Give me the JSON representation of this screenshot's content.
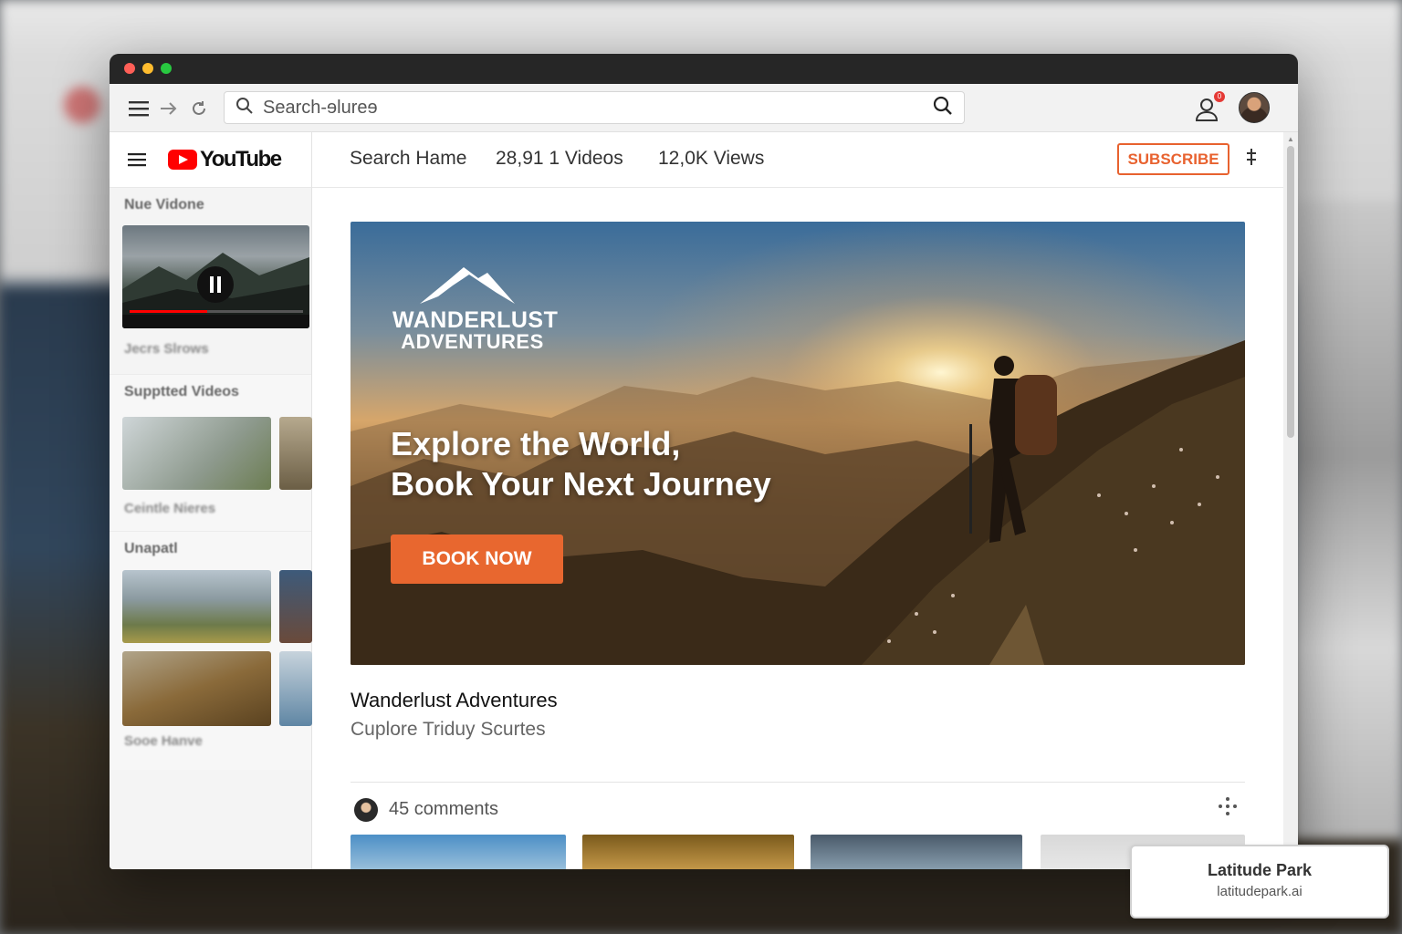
{
  "toolbar": {
    "search_placeholder": "Search-ɘlureɘ"
  },
  "notifications": {
    "badge": "0"
  },
  "youtube": {
    "wordmark": "YouTube"
  },
  "sidebar": {
    "section1_title": "Nue Vidone",
    "section1_caption": "Jecrs Slrows",
    "section2_title": "Supptted Videos",
    "section2_caption": "Ceintle Nieres",
    "section3_title": "Unapatl",
    "section3_caption": "Sooe Hanve"
  },
  "main_header": {
    "title": "Search Hame",
    "video_count": "28,91 1 Videos",
    "views": "12,0K Views",
    "subscribe": "SUBSCRIBE"
  },
  "hero": {
    "brand_line1": "WANDERLUST",
    "brand_line2": "ADVENTURES",
    "headline_line1": "Explore the World,",
    "headline_line2": "Book Your Next Journey",
    "cta": "BOOK NOW"
  },
  "video": {
    "title": "Wanderlust Adventures",
    "subtitle": "Cuplore Triduy Scurtes"
  },
  "comments": {
    "count": "45 comments"
  },
  "watermark": {
    "name": "Latitude Park",
    "url": "latitudepark.ai"
  }
}
